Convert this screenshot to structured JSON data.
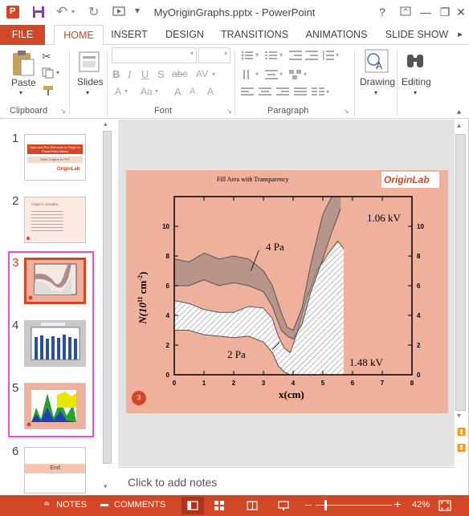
{
  "window": {
    "title": "MyOriginGraphs.pptx - PowerPoint"
  },
  "tabs": [
    {
      "label": "FILE"
    },
    {
      "label": "HOME"
    },
    {
      "label": "INSERT"
    },
    {
      "label": "DESIGN"
    },
    {
      "label": "TRANSITIONS"
    },
    {
      "label": "ANIMATIONS"
    },
    {
      "label": "SLIDE SHOW"
    }
  ],
  "ribbon": {
    "paste_label": "Paste",
    "slides_label": "Slides",
    "drawing_label": "Drawing",
    "editing_label": "Editing",
    "groups": {
      "clipboard": "Clipboard",
      "font": "Font",
      "paragraph": "Paragraph"
    }
  },
  "thumbnails": [
    {
      "number": "1",
      "title": "Data and Plot Elements in Origin to PowerPoint Slides",
      "subtitle": "Send Graphs to PPT",
      "logo": "OriginLab"
    },
    {
      "number": "2",
      "heading": "Origin's Includes:"
    },
    {
      "number": "3",
      "badge": "3"
    },
    {
      "number": "4"
    },
    {
      "number": "5"
    },
    {
      "number": "6",
      "text": "End"
    }
  ],
  "slide": {
    "title": "Fill Area with Transparency",
    "logo": "OriginLab",
    "number_badge": "3",
    "ylabel_main": "N(10",
    "ylabel_sup": "11",
    "ylabel_unit": " cm",
    "ylabel_sup2": "-2",
    "ylabel_close": ")",
    "xlabel": "x(cm)",
    "annotations": {
      "top_right": "1.06 kV",
      "bottom_right": "1.48 kV",
      "label_4pa": "4 Pa",
      "label_2pa": "2 Pa"
    },
    "x_ticks": [
      "0",
      "1",
      "2",
      "3",
      "4",
      "5",
      "6",
      "7",
      "8"
    ],
    "y_ticks": [
      "0",
      "2",
      "4",
      "6",
      "8",
      "10"
    ]
  },
  "chart_data": {
    "type": "area",
    "title": "Fill Area with Transparency",
    "xlabel": "x(cm)",
    "ylabel": "N(10^11 cm^-2)",
    "xlim": [
      0,
      8
    ],
    "ylim": [
      0,
      12
    ],
    "series": [
      {
        "name": "4 Pa",
        "x": [
          0,
          0.5,
          1,
          1.5,
          2,
          2.5,
          3,
          3.3,
          3.6,
          3.8,
          4.0,
          4.3,
          4.6,
          5.0,
          5.3,
          5.6
        ],
        "upper": [
          7.8,
          7.6,
          8.2,
          7.8,
          8.0,
          7.8,
          7.0,
          6.0,
          4.2,
          3.2,
          3.0,
          4.5,
          7.5,
          10.8,
          12.0,
          12.0
        ],
        "lower": [
          6.0,
          6.0,
          6.4,
          6.0,
          6.2,
          6.0,
          5.6,
          4.6,
          3.0,
          2.6,
          2.4,
          3.4,
          5.6,
          7.8,
          9.6,
          11.2
        ]
      },
      {
        "name": "2 Pa",
        "x": [
          0,
          0.5,
          1,
          1.5,
          2,
          2.5,
          3,
          3.3,
          3.5,
          3.7,
          3.9,
          4.1,
          4.4,
          4.8,
          5.2,
          5.5,
          5.7
        ],
        "upper": [
          5.0,
          4.8,
          4.4,
          4.2,
          4.2,
          4.6,
          4.5,
          3.8,
          2.6,
          1.8,
          1.5,
          2.6,
          4.8,
          7.0,
          8.2,
          9.0,
          8.5
        ],
        "lower": [
          3.0,
          3.0,
          2.7,
          2.6,
          2.5,
          2.6,
          2.2,
          1.5,
          0.6,
          0.2,
          0.0,
          0.0,
          0.0,
          0.0,
          0.0,
          0.0,
          0.0
        ]
      }
    ]
  },
  "notes": {
    "placeholder": "Click to add notes"
  },
  "status": {
    "notes": "NOTES",
    "comments": "COMMENTS",
    "zoom": "42%"
  }
}
